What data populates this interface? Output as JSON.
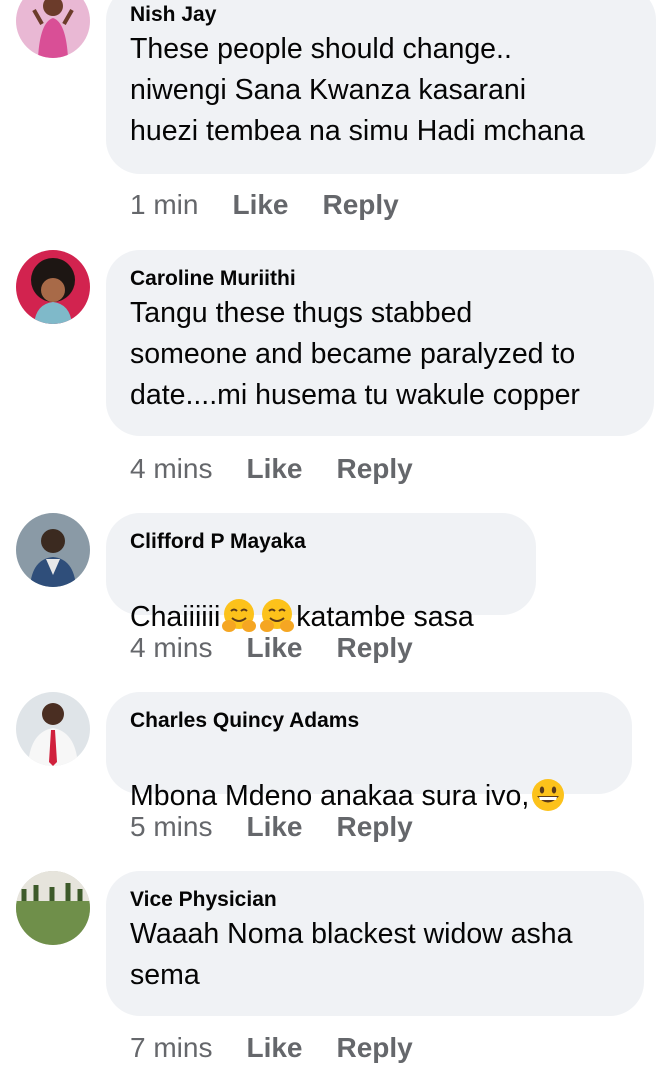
{
  "comments": [
    {
      "author": "Nish Jay",
      "text": "These people should change..\nniwengi Sana Kwanza kasarani\nhuezi tembea na simu Hadi mchana",
      "time": "1 min",
      "like": "Like",
      "reply": "Reply"
    },
    {
      "author": "Caroline Muriithi",
      "text": "Tangu these thugs stabbed\nsomeone and became paralyzed to\ndate....mi husema tu wakule copper",
      "time": "4 mins",
      "like": "Like",
      "reply": "Reply"
    },
    {
      "author": "Clifford P Mayaka",
      "text_before": "Chaiiiiii",
      "text_after": "katambe sasa",
      "time": "4 mins",
      "like": "Like",
      "reply": "Reply"
    },
    {
      "author": "Charles Quincy Adams",
      "text_before": "Mbona Mdeno anakaa sura ivo,",
      "time": "5 mins",
      "like": "Like",
      "reply": "Reply"
    },
    {
      "author": "Vice Physician",
      "text": "Waaah Noma blackest widow asha\nsema",
      "time": "7 mins",
      "like": "Like",
      "reply": "Reply"
    }
  ],
  "icons": {
    "hugging_face": "hugging-face-emoji",
    "grinning_face": "grinning-face-emoji"
  },
  "colors": {
    "bubble": "#f0f2f5",
    "secondary_text": "#65676b",
    "primary_text": "#050505"
  }
}
